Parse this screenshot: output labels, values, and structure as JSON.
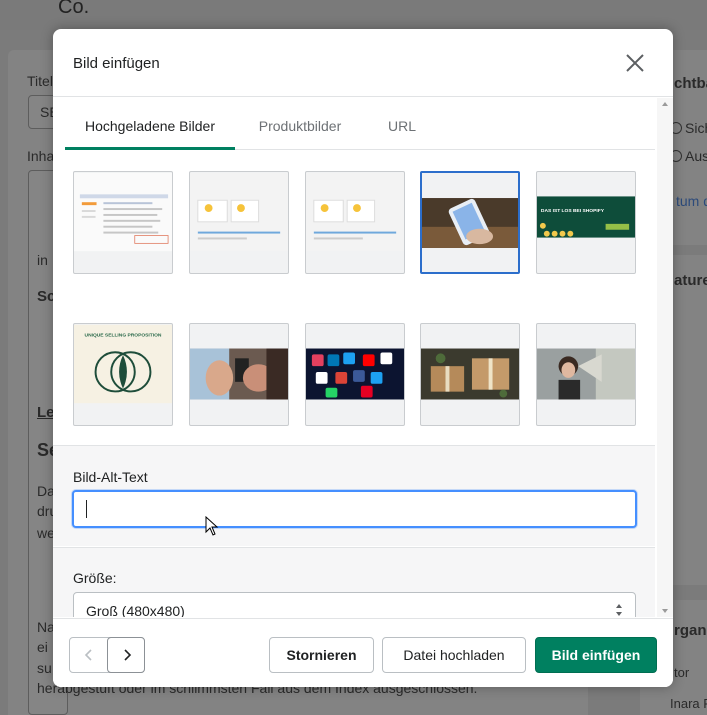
{
  "background": {
    "company": "Co.",
    "left_labels": [
      "Titel",
      "Inha",
      "in",
      "Sc",
      "Le",
      "Se",
      "Da",
      "dru",
      "we",
      "Na",
      "ei",
      "su"
    ],
    "bottom_line": "herabgestuft oder im schlimmsten Fall aus dem Index ausgeschlossen.",
    "right_labels": [
      "chtba",
      "Sich",
      "Aus",
      "tum d",
      "ature",
      "rgani",
      "tor",
      "Inara F"
    ],
    "left_input_value": "SE"
  },
  "modal": {
    "title": "Bild einfügen",
    "tabs": [
      {
        "label": "Hochgeladene Bilder",
        "active": true
      },
      {
        "label": "Produktbilder",
        "active": false
      },
      {
        "label": "URL",
        "active": false
      }
    ],
    "images": [
      {
        "icon": "screenshot-table-image",
        "selected": false
      },
      {
        "icon": "lightbulb-cards-image",
        "selected": false
      },
      {
        "icon": "lightbulb-cards-image-2",
        "selected": false
      },
      {
        "icon": "smartphone-hand-image",
        "selected": true
      },
      {
        "icon": "shopify-banner-image",
        "selected": false,
        "text": "DAS IST LOS BEI SHOPIFY"
      },
      {
        "icon": "usp-venn-diagram-image",
        "selected": false,
        "text": "UNIQUE SELLING PROPOSITION"
      },
      {
        "icon": "hands-phones-image",
        "selected": false
      },
      {
        "icon": "social-media-icons-image",
        "selected": false
      },
      {
        "icon": "gift-packages-image",
        "selected": false
      },
      {
        "icon": "woman-megaphone-image",
        "selected": false
      }
    ],
    "alt_text": {
      "label": "Bild-Alt-Text",
      "value": ""
    },
    "size": {
      "label": "Größe:",
      "selected": "Groß (480x480)"
    },
    "buttons": {
      "cancel": "Stornieren",
      "upload": "Datei hochladen",
      "insert": "Bild einfügen"
    }
  },
  "colors": {
    "primary": "#008060",
    "focus": "#458fff",
    "selected_border": "#2c6ecb"
  }
}
